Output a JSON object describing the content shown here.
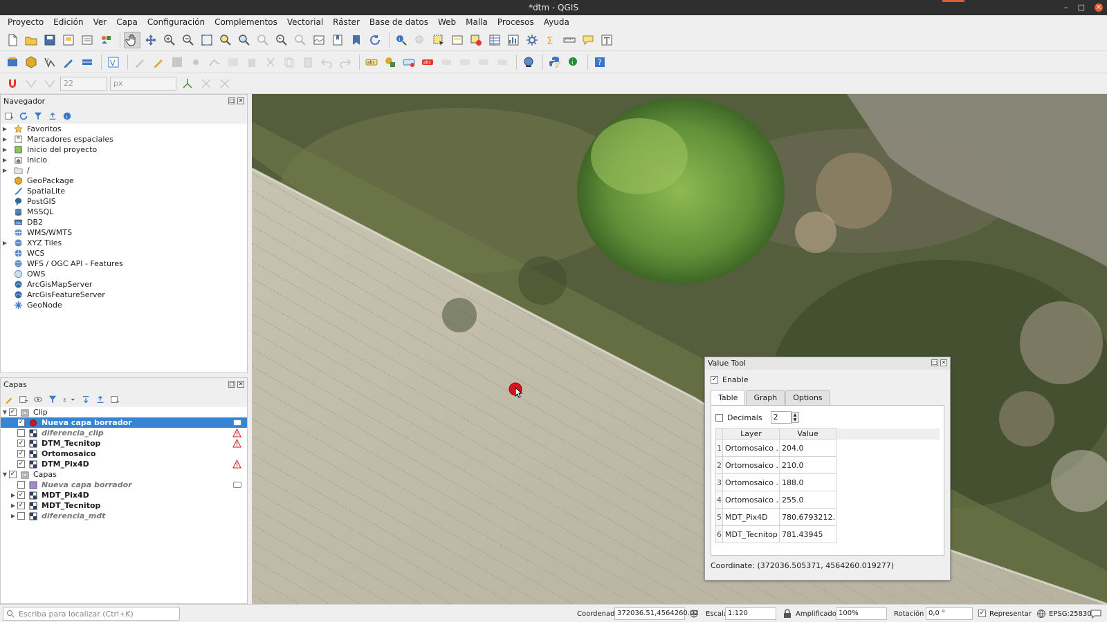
{
  "window": {
    "title": "*dtm - QGIS"
  },
  "menubar": [
    "Proyecto",
    "Edición",
    "Ver",
    "Capa",
    "Configuración",
    "Complementos",
    "Vectorial",
    "Ráster",
    "Base de datos",
    "Web",
    "Malla",
    "Procesos",
    "Ayuda"
  ],
  "toolbar3": {
    "tolerance_value": "22",
    "units_value": "px"
  },
  "navigator": {
    "title": "Navegador",
    "items": [
      {
        "label": "Favoritos",
        "icon": "star-icon",
        "expandable": true
      },
      {
        "label": "Marcadores espaciales",
        "icon": "bookmark-icon",
        "expandable": true
      },
      {
        "label": "Inicio del proyecto",
        "icon": "project-home-icon",
        "expandable": true
      },
      {
        "label": "Inicio",
        "icon": "home-folder-icon",
        "expandable": true
      },
      {
        "label": "/",
        "icon": "folder-icon",
        "expandable": true
      },
      {
        "label": "GeoPackage",
        "icon": "geopackage-icon",
        "expandable": false
      },
      {
        "label": "SpatiaLite",
        "icon": "spatialite-icon",
        "expandable": false
      },
      {
        "label": "PostGIS",
        "icon": "postgis-icon",
        "expandable": false
      },
      {
        "label": "MSSQL",
        "icon": "mssql-icon",
        "expandable": false
      },
      {
        "label": "DB2",
        "icon": "db2-icon",
        "expandable": false
      },
      {
        "label": "WMS/WMTS",
        "icon": "wms-icon",
        "expandable": false
      },
      {
        "label": "XYZ Tiles",
        "icon": "xyz-tiles-icon",
        "expandable": true
      },
      {
        "label": "WCS",
        "icon": "wcs-icon",
        "expandable": false
      },
      {
        "label": "WFS / OGC API - Features",
        "icon": "wfs-icon",
        "expandable": false
      },
      {
        "label": "OWS",
        "icon": "ows-icon",
        "expandable": false
      },
      {
        "label": "ArcGisMapServer",
        "icon": "arcgis-icon",
        "expandable": false
      },
      {
        "label": "ArcGisFeatureServer",
        "icon": "arcgis-icon",
        "expandable": false
      },
      {
        "label": "GeoNode",
        "icon": "geonode-icon",
        "expandable": false
      }
    ]
  },
  "layers": {
    "title": "Capas",
    "groups": [
      {
        "name": "Clip",
        "checked": true,
        "children": [
          {
            "name": "Nueva capa borrador",
            "checked": true,
            "italic": false,
            "selected": true,
            "icon": "point-layer-icon",
            "badge": "edit"
          },
          {
            "name": "diferencia_clip",
            "checked": false,
            "italic": true,
            "selected": false,
            "icon": "raster-icon",
            "badge": "warning"
          },
          {
            "name": "DTM_Tecnitop",
            "checked": true,
            "italic": false,
            "selected": false,
            "icon": "raster-icon",
            "badge": "warning"
          },
          {
            "name": "Ortomosaico",
            "checked": true,
            "italic": false,
            "selected": false,
            "icon": "raster-icon",
            "badge": ""
          },
          {
            "name": "DTM_Pix4D",
            "checked": true,
            "italic": false,
            "selected": false,
            "icon": "raster-icon",
            "badge": "warning"
          }
        ]
      },
      {
        "name": "Capas",
        "checked": true,
        "children": [
          {
            "name": "Nueva capa borrador",
            "checked": false,
            "italic": true,
            "selected": false,
            "icon": "polygon-layer-icon",
            "badge": "edit"
          },
          {
            "name": "MDT_Pix4D",
            "checked": true,
            "italic": false,
            "selected": false,
            "icon": "raster-icon",
            "badge": "",
            "expandable": true
          },
          {
            "name": "MDT_Tecnitop",
            "checked": true,
            "italic": false,
            "selected": false,
            "icon": "raster-icon",
            "badge": "",
            "expandable": true
          },
          {
            "name": "diferencia_mdt",
            "checked": false,
            "italic": true,
            "selected": false,
            "icon": "raster-icon",
            "badge": "",
            "expandable": true
          }
        ]
      }
    ]
  },
  "value_tool": {
    "title": "Value Tool",
    "enable_label": "Enable",
    "enable_checked": true,
    "tabs": [
      "Table",
      "Graph",
      "Options"
    ],
    "active_tab": "Table",
    "decimals_label": "Decimals",
    "decimals_checked": false,
    "decimals_value": "2",
    "col_layer": "Layer",
    "col_value": "Value",
    "rows": [
      {
        "n": "1",
        "layer": "Ortomosaico ...",
        "value": "204.0"
      },
      {
        "n": "2",
        "layer": "Ortomosaico ...",
        "value": "210.0"
      },
      {
        "n": "3",
        "layer": "Ortomosaico ...",
        "value": "188.0"
      },
      {
        "n": "4",
        "layer": "Ortomosaico ...",
        "value": "255.0"
      },
      {
        "n": "5",
        "layer": "MDT_Pix4D",
        "value": "780.6793212..."
      },
      {
        "n": "6",
        "layer": "MDT_Tecnitop",
        "value": "781.43945"
      }
    ],
    "coordinate": "Coordinate: (372036.505371, 4564260.019277)"
  },
  "statusbar": {
    "locator_placeholder": "Escriba para localizar (Ctrl+K)",
    "coord_label": "Coordenada",
    "coord_value": "372036.51,4564260.02",
    "scale_label": "Escala",
    "scale_value": "1:120",
    "magnifier_label": "Amplificador",
    "magnifier_value": "100%",
    "rotation_label": "Rotación",
    "rotation_value": "0,0 °",
    "render_label": "Representar",
    "render_checked": true,
    "crs": "EPSG:25830"
  },
  "colors": {
    "selection": "#3584d6",
    "titlebar": "#2f2f2f",
    "marker": "#d9131c"
  }
}
